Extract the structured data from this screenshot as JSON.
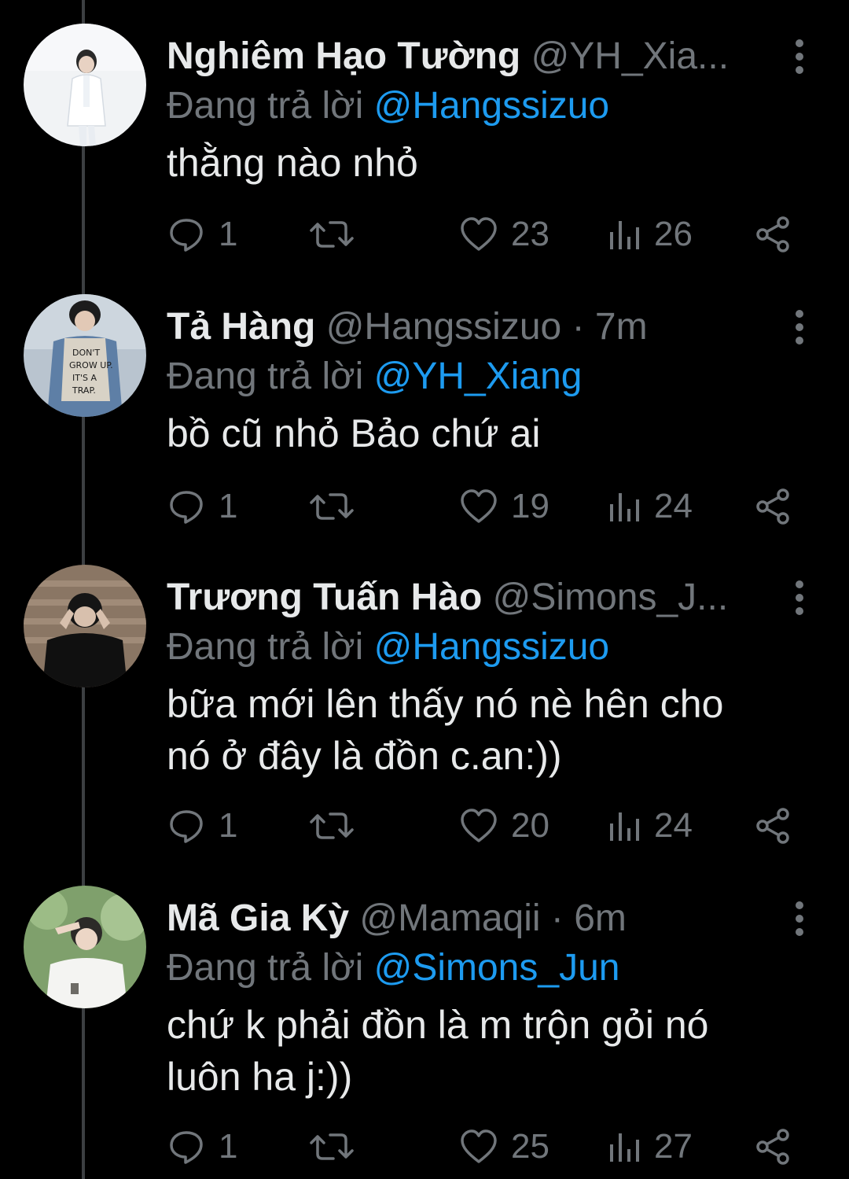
{
  "colors": {
    "background": "#000000",
    "text_primary": "#e7e9ea",
    "text_secondary": "#71767b",
    "mention": "#1d9bf0",
    "thread_line": "#3c3f42"
  },
  "icons": {
    "reply": "reply-icon",
    "retweet": "retweet-icon",
    "like": "heart-icon",
    "views": "views-icon",
    "share": "share-icon",
    "more": "more-options-icon"
  },
  "tweets": [
    {
      "name": "Nghiêm Hạo Tường",
      "handle": "@YH_Xia...",
      "time": "",
      "reply_label": "Đang trả lời",
      "reply_to": "@Hangssizuo",
      "text": "thằng nào nhỏ",
      "replies": "1",
      "retweets": "",
      "likes": "23",
      "views": "26"
    },
    {
      "name": "Tả Hàng",
      "handle": "@Hangssizuo",
      "separator": "·",
      "time": "7m",
      "reply_label": "Đang trả lời",
      "reply_to": "@YH_Xiang",
      "text": "bồ cũ nhỏ Bảo chứ ai",
      "replies": "1",
      "retweets": "",
      "likes": "19",
      "views": "24"
    },
    {
      "name": "Trương Tuấn Hào",
      "handle": "@Simons_J...",
      "time": "",
      "reply_label": "Đang trả lời",
      "reply_to": "@Hangssizuo",
      "text": "bữa mới lên thấy nó nè hên cho\nnó ở đây là đồn c.an:))",
      "replies": "1",
      "retweets": "",
      "likes": "20",
      "views": "24"
    },
    {
      "name": "Mã Gia Kỳ",
      "handle": "@Mamaqii",
      "separator": "·",
      "time": "6m",
      "reply_label": "Đang trả lời",
      "reply_to": "@Simons_Jun",
      "text": "chứ k phải đồn là m trộn gỏi nó\nluôn ha j:))",
      "replies": "1",
      "retweets": "",
      "likes": "25",
      "views": "27"
    }
  ]
}
